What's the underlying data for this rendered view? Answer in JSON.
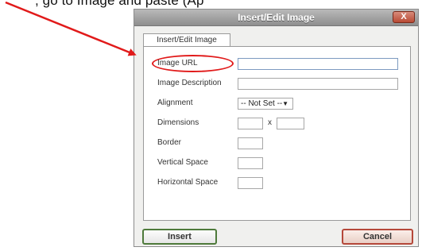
{
  "caption": {
    "text": ", go to Image and paste (Ap"
  },
  "dialog": {
    "title": "Insert/Edit Image",
    "close_label": "X",
    "tab_label": "Insert/Edit Image",
    "fields": {
      "image_url": {
        "label": "Image URL",
        "value": ""
      },
      "image_description": {
        "label": "Image Description",
        "value": ""
      },
      "alignment": {
        "label": "Alignment",
        "selected": "-- Not Set --"
      },
      "dimensions": {
        "label": "Dimensions",
        "separator": "x",
        "width": "",
        "height": ""
      },
      "border": {
        "label": "Border",
        "value": ""
      },
      "vertical_space": {
        "label": "Vertical Space",
        "value": ""
      },
      "horizontal_space": {
        "label": "Horizontal Space",
        "value": ""
      }
    },
    "buttons": {
      "insert": "Insert",
      "cancel": "Cancel"
    }
  },
  "colors": {
    "annotation": "#e11a1a",
    "titlebar": "#9f9f9f",
    "insert_border": "#4e7a3b",
    "cancel_border": "#b5483a"
  }
}
